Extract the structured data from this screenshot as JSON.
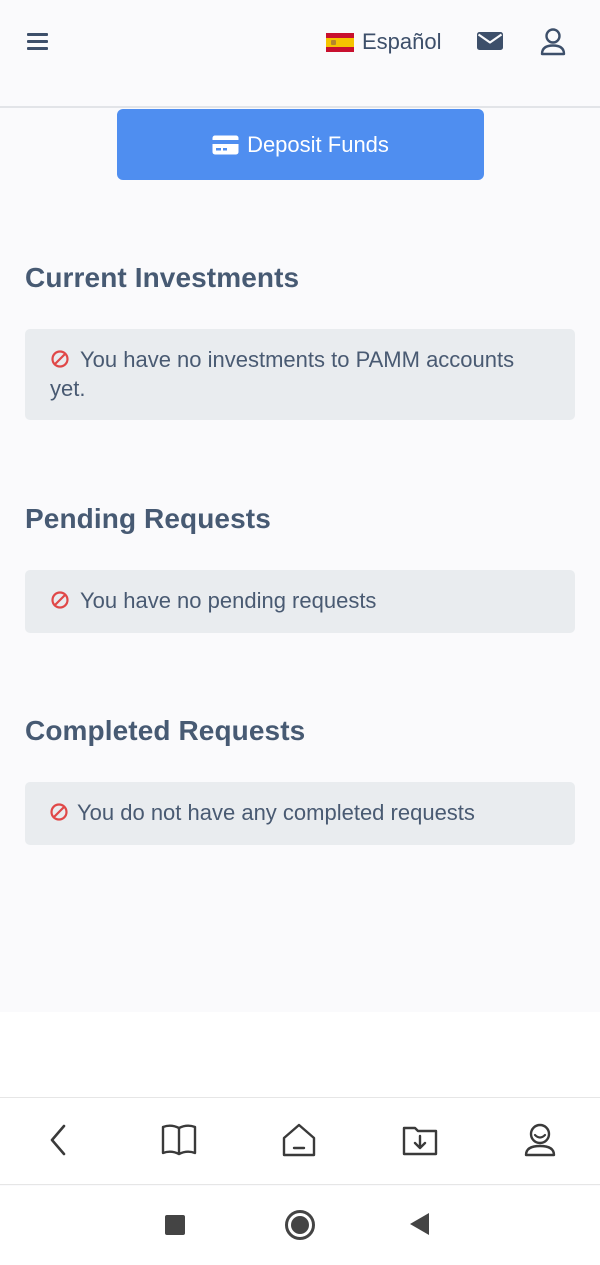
{
  "header": {
    "language": "Español"
  },
  "deposit_button": {
    "label": "Deposit Funds"
  },
  "sections": [
    {
      "title": "Current Investments",
      "notice": "You have no investments to PAMM accounts yet."
    },
    {
      "title": "Pending Requests",
      "notice": "You have no pending requests"
    },
    {
      "title": "Completed Requests",
      "notice": "You do not have any completed requests"
    }
  ],
  "colors": {
    "primary_button": "#4f8ef0",
    "notice_icon": "#e04848",
    "heading": "#475a73",
    "notice_bg": "#e9ecef"
  },
  "icons": {
    "header": [
      "hamburger-menu-icon",
      "spain-flag-icon",
      "envelope-icon",
      "user-icon"
    ],
    "deposit": "credit-card-icon",
    "notice": "ban-icon",
    "browser_nav": [
      "back-icon",
      "book-icon",
      "home-icon",
      "download-icon",
      "profile-icon"
    ],
    "system_nav": [
      "recents-square-icon",
      "home-circle-icon",
      "back-triangle-icon"
    ]
  }
}
